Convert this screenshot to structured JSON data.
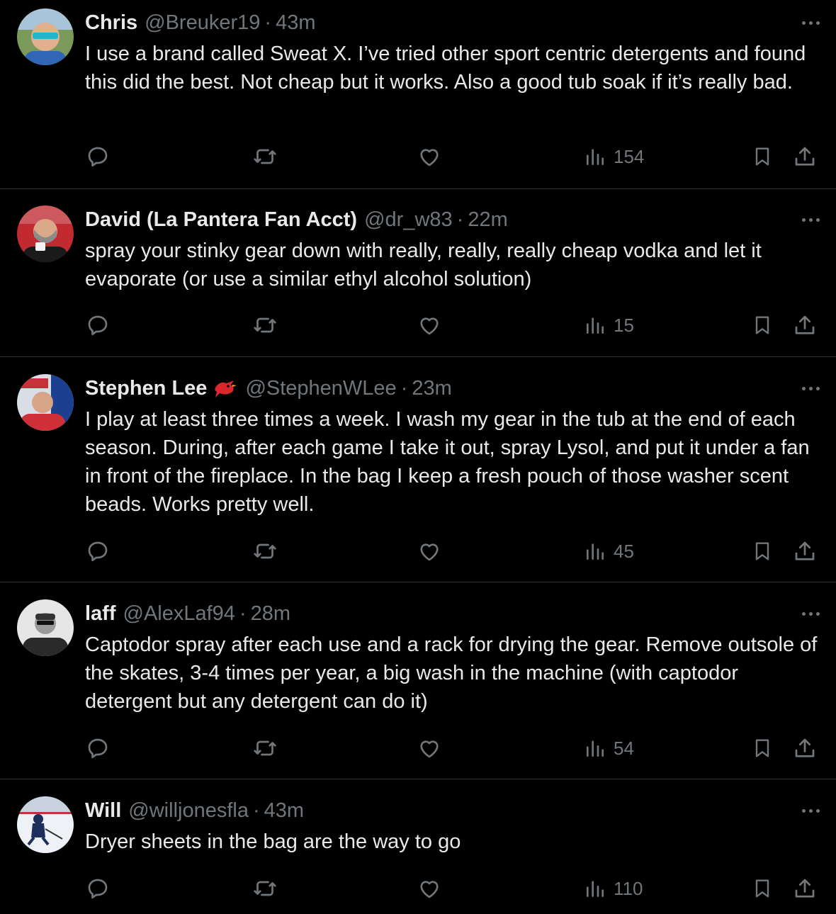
{
  "tweets": [
    {
      "name": "Chris",
      "handle": "@Breuker19",
      "time": "43m",
      "text": "I use a brand called Sweat X. I’ve tried other sport centric detergents and found this did the best. Not cheap but it works. Also a good tub soak if it’s really bad.",
      "views": "154",
      "avatar_color": "#4a7db8"
    },
    {
      "name": "David (La Pantera Fan Acct)",
      "handle": "@dr_w83",
      "time": "22m",
      "text": "spray your stinky gear down with really, really, really cheap vodka and let it evaporate (or use a similar ethyl alcohol solution)",
      "views": "15",
      "avatar_color": "#b3262e"
    },
    {
      "name": "Stephen Lee",
      "handle": "@StephenWLee",
      "time": "23m",
      "text": "I play at least three times a week. I wash my gear in the tub at the end of each season. During, after each game I take it out, spray Lysol, and put it under a fan in front of the fireplace. In the bag I keep a fresh pouch of those washer scent beads. Works pretty well.",
      "views": "45",
      "avatar_color": "#c7323a"
    },
    {
      "name": "laff",
      "handle": "@AlexLaf94",
      "time": "28m",
      "text": "Captodor  spray after each use and a rack for drying the gear. Remove outsole of the skates, 3-4 times per year, a big wash in the machine (with captodor detergent but any detergent can do it)",
      "views": "54",
      "avatar_color": "#8a8a8a"
    },
    {
      "name": "Will",
      "handle": "@willjonesfla",
      "time": "43m",
      "text": "Dryer sheets in the bag are the way to go",
      "views": "110",
      "avatar_color": "#dfe6ee"
    }
  ],
  "icons": {
    "reply": "reply-icon",
    "retweet": "retweet-icon",
    "like": "heart-icon",
    "views": "views-icon",
    "bookmark": "bookmark-icon",
    "share": "share-icon",
    "more": "more-icon",
    "badge": "bird-emoji-icon"
  },
  "colors": {
    "background": "#000000",
    "text": "#e7e9ea",
    "secondary": "#71767b",
    "divider": "#2f3336"
  }
}
